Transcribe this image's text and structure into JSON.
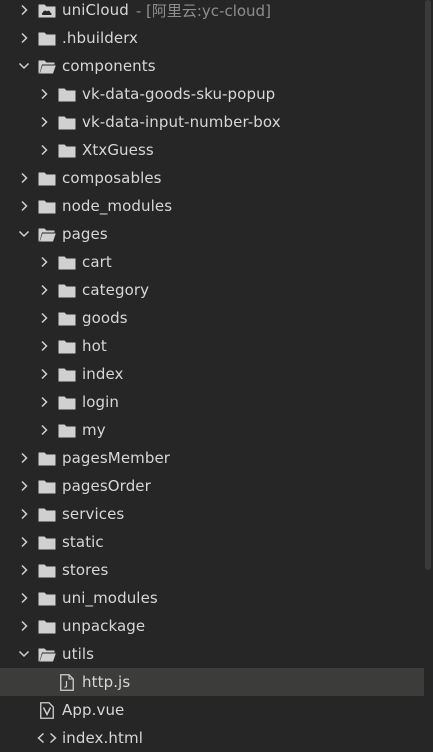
{
  "colors": {
    "background": "#262626",
    "selected_row": "#3c3c3a",
    "text": "#d7d7d7",
    "muted_text": "#8e8e8e",
    "icon": "#d0d0d0"
  },
  "tree": [
    {
      "label": "uniCloud",
      "suffix": "- [阿里云:yc-cloud]",
      "type": "cloud-folder",
      "depth": 0,
      "expanded": false,
      "icon": "cloud-folder-icon"
    },
    {
      "label": ".hbuilderx",
      "type": "folder",
      "depth": 0,
      "expanded": false,
      "icon": "folder-icon"
    },
    {
      "label": "components",
      "type": "folder",
      "depth": 0,
      "expanded": true,
      "icon": "folder-open-icon"
    },
    {
      "label": "vk-data-goods-sku-popup",
      "type": "folder",
      "depth": 1,
      "expanded": false,
      "icon": "folder-icon"
    },
    {
      "label": "vk-data-input-number-box",
      "type": "folder",
      "depth": 1,
      "expanded": false,
      "icon": "folder-icon"
    },
    {
      "label": "XtxGuess",
      "type": "folder",
      "depth": 1,
      "expanded": false,
      "icon": "folder-icon"
    },
    {
      "label": "composables",
      "type": "folder",
      "depth": 0,
      "expanded": false,
      "icon": "folder-icon"
    },
    {
      "label": "node_modules",
      "type": "folder",
      "depth": 0,
      "expanded": false,
      "icon": "folder-icon"
    },
    {
      "label": "pages",
      "type": "folder",
      "depth": 0,
      "expanded": true,
      "icon": "folder-open-icon"
    },
    {
      "label": "cart",
      "type": "folder",
      "depth": 1,
      "expanded": false,
      "icon": "folder-icon"
    },
    {
      "label": "category",
      "type": "folder",
      "depth": 1,
      "expanded": false,
      "icon": "folder-icon"
    },
    {
      "label": "goods",
      "type": "folder",
      "depth": 1,
      "expanded": false,
      "icon": "folder-icon"
    },
    {
      "label": "hot",
      "type": "folder",
      "depth": 1,
      "expanded": false,
      "icon": "folder-icon"
    },
    {
      "label": "index",
      "type": "folder",
      "depth": 1,
      "expanded": false,
      "icon": "folder-icon"
    },
    {
      "label": "login",
      "type": "folder",
      "depth": 1,
      "expanded": false,
      "icon": "folder-icon"
    },
    {
      "label": "my",
      "type": "folder",
      "depth": 1,
      "expanded": false,
      "icon": "folder-icon"
    },
    {
      "label": "pagesMember",
      "type": "folder",
      "depth": 0,
      "expanded": false,
      "icon": "folder-icon"
    },
    {
      "label": "pagesOrder",
      "type": "folder",
      "depth": 0,
      "expanded": false,
      "icon": "folder-icon"
    },
    {
      "label": "services",
      "type": "folder",
      "depth": 0,
      "expanded": false,
      "icon": "folder-icon"
    },
    {
      "label": "static",
      "type": "folder",
      "depth": 0,
      "expanded": false,
      "icon": "folder-icon"
    },
    {
      "label": "stores",
      "type": "folder",
      "depth": 0,
      "expanded": false,
      "icon": "folder-icon"
    },
    {
      "label": "uni_modules",
      "type": "folder",
      "depth": 0,
      "expanded": false,
      "icon": "folder-icon"
    },
    {
      "label": "unpackage",
      "type": "folder",
      "depth": 0,
      "expanded": false,
      "icon": "folder-icon"
    },
    {
      "label": "utils",
      "type": "folder",
      "depth": 0,
      "expanded": true,
      "icon": "folder-open-icon"
    },
    {
      "label": "http.js",
      "type": "file",
      "depth": 1,
      "selected": true,
      "icon": "js-file-icon"
    },
    {
      "label": "App.vue",
      "type": "file",
      "depth": 0,
      "icon": "vue-file-icon"
    },
    {
      "label": "index.html",
      "type": "file",
      "depth": 0,
      "icon": "html-file-icon"
    }
  ]
}
